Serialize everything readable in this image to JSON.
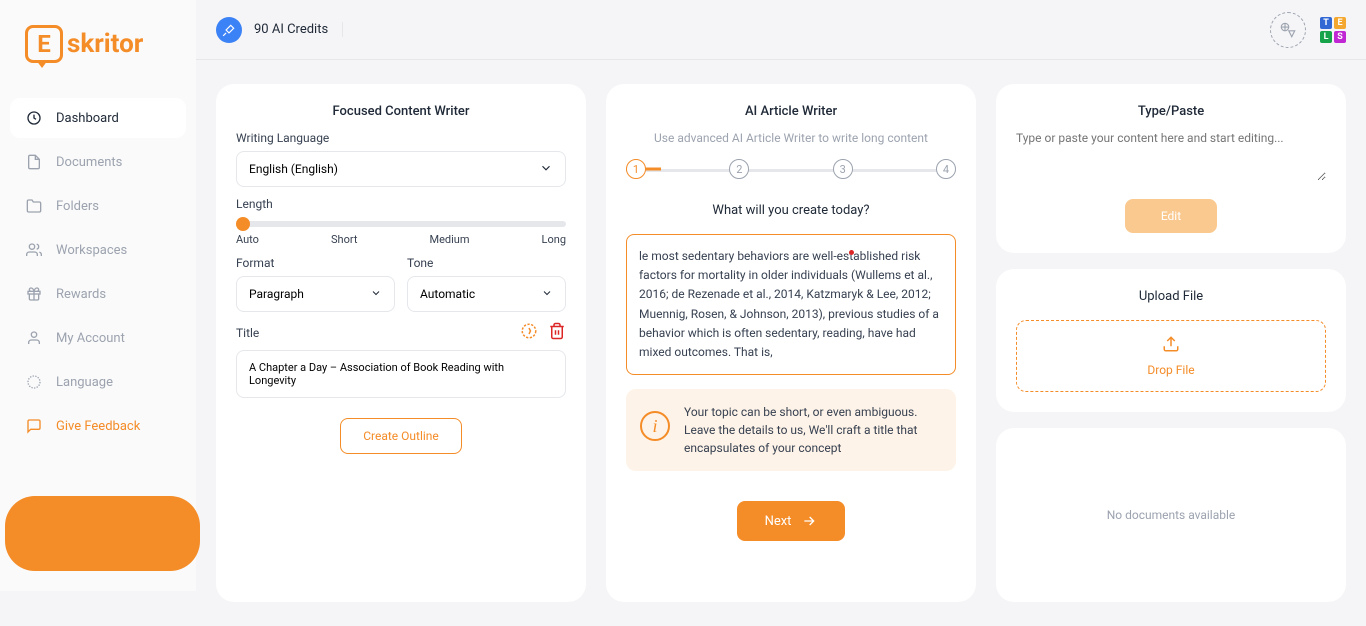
{
  "brand": "skritor",
  "credits": "90 AI Credits",
  "nav": {
    "dashboard": "Dashboard",
    "documents": "Documents",
    "folders": "Folders",
    "workspaces": "Workspaces",
    "rewards": "Rewards",
    "account": "My Account",
    "language": "Language",
    "feedback": "Give Feedback"
  },
  "card1": {
    "title": "Focused Content Writer",
    "lang_label": "Writing Language",
    "lang_value": "English (English)",
    "length_label": "Length",
    "slider": {
      "v1": "Auto",
      "v2": "Short",
      "v3": "Medium",
      "v4": "Long"
    },
    "format_label": "Format",
    "format_value": "Paragraph",
    "tone_label": "Tone",
    "tone_value": "Automatic",
    "title_label": "Title",
    "title_value": "A Chapter a Day – Association of Book Reading with Longevity",
    "button": "Create Outline"
  },
  "card2": {
    "title": "AI Article Writer",
    "subtitle": "Use advanced AI Article Writer to write long content",
    "steps": {
      "s1": "1",
      "s2": "2",
      "s3": "3",
      "s4": "4"
    },
    "question": "What will you create today?",
    "topic": "le most sedentary behaviors are well-established risk factors for mortality in older individuals (Wullems et al., 2016; de Rezenade et al., 2014, Katzmaryk & Lee, 2012; Muennig, Rosen, & Johnson, 2013), previous studies of a behavior which is often sedentary, reading, have had mixed outcomes. That is,",
    "info": "Your topic can be short, or even ambiguous. Leave the details to us, We'll craft a title that encapsulates of your concept",
    "next": "Next"
  },
  "card3": {
    "title": "Type/Paste",
    "placeholder": "Type or paste your content here and start editing...",
    "edit": "Edit"
  },
  "card4": {
    "title": "Upload File",
    "drop": "Drop File"
  },
  "card5": {
    "empty": "No documents available"
  }
}
